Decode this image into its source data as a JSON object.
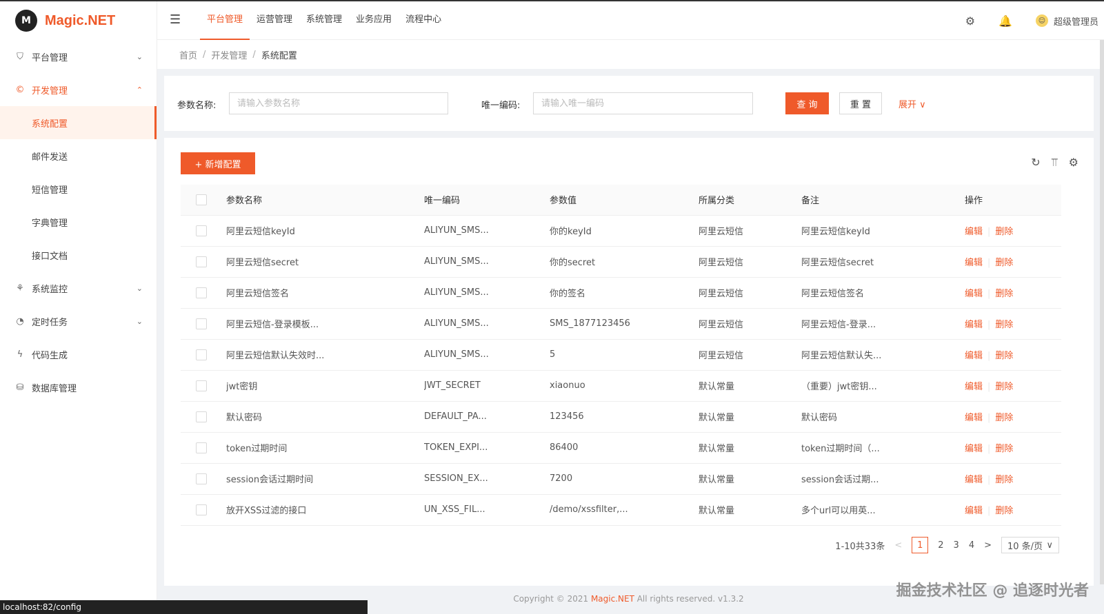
{
  "app": {
    "logo_mark": "M",
    "logo_text": "Magic.NET"
  },
  "sidebar": {
    "items": [
      {
        "icon": "shield-icon",
        "glyph": "⛉",
        "label": "平台管理",
        "arrow": "⌄"
      },
      {
        "icon": "copyright-icon",
        "glyph": "©",
        "label": "开发管理",
        "arrow": "⌃"
      },
      {
        "icon": "monitor-icon",
        "glyph": "⚘",
        "label": "系统监控",
        "arrow": "⌄"
      },
      {
        "icon": "clock-icon",
        "glyph": "◔",
        "label": "定时任务",
        "arrow": "⌄"
      },
      {
        "icon": "thunder-icon",
        "glyph": "ϟ",
        "label": "代码生成"
      },
      {
        "icon": "database-icon",
        "glyph": "⛁",
        "label": "数据库管理"
      }
    ],
    "sub_items": [
      "系统配置",
      "邮件发送",
      "短信管理",
      "字典管理",
      "接口文档"
    ]
  },
  "header": {
    "collapse_glyph": "☰",
    "nav": [
      "平台管理",
      "运营管理",
      "系统管理",
      "业务应用",
      "流程中心"
    ],
    "settings_glyph": "⚙",
    "bell_glyph": "🔔",
    "avatar_glyph": "☺",
    "user_name": "超级管理员"
  },
  "breadcrumb": [
    "首页",
    "开发管理",
    "系统配置"
  ],
  "breadcrumb_sep": "/",
  "search": {
    "name_label": "参数名称:",
    "name_placeholder": "请输入参数名称",
    "code_label": "唯一编码:",
    "code_placeholder": "请输入唯一编码",
    "query_label": "查 询",
    "reset_label": "重 置",
    "expand_label": "展开 ∨"
  },
  "table": {
    "add_label": "+  新增配置",
    "tool_glyphs": [
      "↻",
      "⫪",
      "⚙"
    ],
    "columns": [
      "参数名称",
      "唯一编码",
      "参数值",
      "所属分类",
      "备注",
      "操作"
    ],
    "rows": [
      [
        "阿里云短信keyId",
        "ALIYUN_SMS...",
        "你的keyId",
        "阿里云短信",
        "阿里云短信keyId"
      ],
      [
        "阿里云短信secret",
        "ALIYUN_SMS...",
        "你的secret",
        "阿里云短信",
        "阿里云短信secret"
      ],
      [
        "阿里云短信签名",
        "ALIYUN_SMS...",
        "你的签名",
        "阿里云短信",
        "阿里云短信签名"
      ],
      [
        "阿里云短信-登录模板...",
        "ALIYUN_SMS...",
        "SMS_1877123456",
        "阿里云短信",
        "阿里云短信-登录..."
      ],
      [
        "阿里云短信默认失效时...",
        "ALIYUN_SMS...",
        "5",
        "阿里云短信",
        "阿里云短信默认失..."
      ],
      [
        "jwt密钥",
        "JWT_SECRET",
        "xiaonuo",
        "默认常量",
        "（重要）jwt密钥..."
      ],
      [
        "默认密码",
        "DEFAULT_PA...",
        "123456",
        "默认常量",
        "默认密码"
      ],
      [
        "token过期时间",
        "TOKEN_EXPI...",
        "86400",
        "默认常量",
        "token过期时间（..."
      ],
      [
        "session会话过期时间",
        "SESSION_EX...",
        "7200",
        "默认常量",
        "session会话过期..."
      ],
      [
        "放开XSS过滤的接口",
        "UN_XSS_FIL...",
        "/demo/xssfilter,...",
        "默认常量",
        "多个url可以用英..."
      ]
    ],
    "edit_label": "编辑",
    "delete_label": "删除",
    "op_sep": "|"
  },
  "pagination": {
    "total_text": "1-10共33条",
    "prev": "<",
    "next": ">",
    "pages": [
      "1",
      "2",
      "3",
      "4"
    ],
    "current": "1",
    "page_size": "10 条/页",
    "size_arrow": "∨"
  },
  "footer": {
    "prefix": "Copyright © 2021 ",
    "brand": "Magic.NET",
    "suffix": " All rights reserved. v1.3.2"
  },
  "status_url": "localhost:82/config",
  "watermark": "掘金技术社区 @ 追逐时光者",
  "colors": {
    "accent": "#ef5a2a"
  }
}
